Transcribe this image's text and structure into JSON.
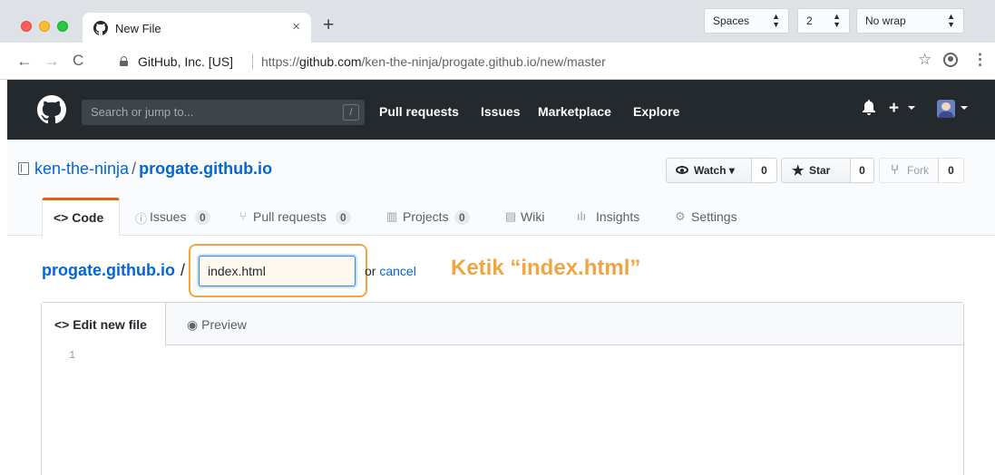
{
  "browser": {
    "tab_title": "New File",
    "tab_close": "×",
    "new_tab": "+",
    "nav": {
      "back": "←",
      "forward": "→",
      "reload": "C"
    },
    "org": "GitHub, Inc. [US]",
    "url_prefix": "https://",
    "url_host": "github.com",
    "url_path": "/ken-the-ninja/progate.github.io/new/master",
    "star_glyph": "☆",
    "menu_glyph": "⋮"
  },
  "github_header": {
    "search_placeholder": "Search or jump to...",
    "search_key": "/",
    "nav": [
      "Pull requests",
      "Issues",
      "Marketplace",
      "Explore"
    ],
    "plus_glyph": "+"
  },
  "repo": {
    "owner": "ken-the-ninja",
    "separator": "/",
    "name": "progate.github.io",
    "watch": {
      "label": "Watch ▾",
      "count": "0"
    },
    "star": {
      "label": "Star",
      "count": "0"
    },
    "fork": {
      "label": "Fork",
      "count": "0"
    },
    "tabs": [
      {
        "icon": "<>",
        "label": "Code"
      },
      {
        "icon": "ⓘ",
        "label": "Issues",
        "count": "0"
      },
      {
        "icon": "⑂",
        "label": "Pull requests",
        "count": "0"
      },
      {
        "icon": "▥",
        "label": "Projects",
        "count": "0"
      },
      {
        "icon": "▤",
        "label": "Wiki"
      },
      {
        "icon": "ılı",
        "label": "Insights"
      },
      {
        "icon": "⚙",
        "label": "Settings"
      }
    ]
  },
  "new_file": {
    "breadcrumb_root": "progate.github.io",
    "breadcrumb_sep": "/",
    "filename_value": "index.html",
    "or_text": "or",
    "cancel_link": "cancel",
    "annotation": "Ketik “index.html”"
  },
  "editor": {
    "tab_edit": "Edit new file",
    "tab_edit_icon": "<>",
    "tab_preview": "Preview",
    "indent_mode": "Spaces",
    "indent_size": "2",
    "wrap_mode": "No wrap",
    "line_numbers": [
      "1"
    ]
  },
  "colors": {
    "annotation": "#f0a540",
    "header_bg": "#24292e",
    "link": "#0366d6",
    "active_tab_border": "#e36209"
  }
}
